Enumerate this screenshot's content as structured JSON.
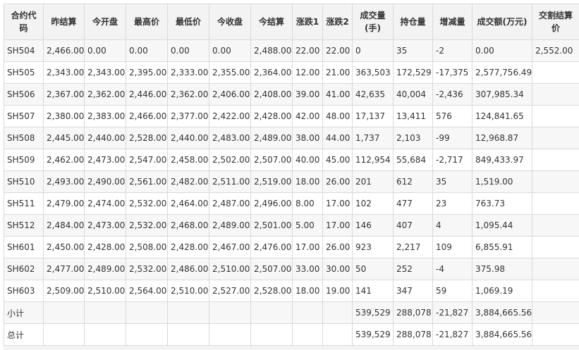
{
  "headers": [
    "合约代码",
    "昨结算",
    "今开盘",
    "最高价",
    "最低价",
    "今收盘",
    "今结算",
    "涨跌1",
    "涨跌2",
    "成交量(手)",
    "持仓量",
    "增减量",
    "成交额(万元)",
    "交割结算价"
  ],
  "rows": [
    [
      "SH504",
      "2,466.00",
      "0.00",
      "0.00",
      "0.00",
      "0.00",
      "2,488.00",
      "22.00",
      "22.00",
      "0",
      "35",
      "-2",
      "0.00",
      "2,552.00"
    ],
    [
      "SH505",
      "2,343.00",
      "2,343.00",
      "2,395.00",
      "2,333.00",
      "2,355.00",
      "2,364.00",
      "12.00",
      "21.00",
      "363,503",
      "172,529",
      "-17,375",
      "2,577,756.49",
      ""
    ],
    [
      "SH506",
      "2,367.00",
      "2,362.00",
      "2,446.00",
      "2,362.00",
      "2,406.00",
      "2,408.00",
      "39.00",
      "41.00",
      "42,635",
      "40,004",
      "-2,436",
      "307,985.34",
      ""
    ],
    [
      "SH507",
      "2,380.00",
      "2,383.00",
      "2,466.00",
      "2,377.00",
      "2,422.00",
      "2,428.00",
      "42.00",
      "48.00",
      "17,137",
      "13,411",
      "576",
      "124,841.65",
      ""
    ],
    [
      "SH508",
      "2,445.00",
      "2,440.00",
      "2,528.00",
      "2,440.00",
      "2,483.00",
      "2,489.00",
      "38.00",
      "44.00",
      "1,737",
      "2,103",
      "-99",
      "12,968.87",
      ""
    ],
    [
      "SH509",
      "2,462.00",
      "2,473.00",
      "2,547.00",
      "2,458.00",
      "2,502.00",
      "2,507.00",
      "40.00",
      "45.00",
      "112,954",
      "55,684",
      "-2,717",
      "849,433.97",
      ""
    ],
    [
      "SH510",
      "2,493.00",
      "2,490.00",
      "2,561.00",
      "2,482.00",
      "2,511.00",
      "2,519.00",
      "18.00",
      "26.00",
      "201",
      "612",
      "35",
      "1,519.00",
      ""
    ],
    [
      "SH511",
      "2,479.00",
      "2,474.00",
      "2,532.00",
      "2,464.00",
      "2,487.00",
      "2,496.00",
      "8.00",
      "17.00",
      "102",
      "477",
      "23",
      "763.73",
      ""
    ],
    [
      "SH512",
      "2,484.00",
      "2,473.00",
      "2,532.00",
      "2,468.00",
      "2,489.00",
      "2,501.00",
      "5.00",
      "17.00",
      "146",
      "407",
      "4",
      "1,095.44",
      ""
    ],
    [
      "SH601",
      "2,450.00",
      "2,428.00",
      "2,508.00",
      "2,428.00",
      "2,467.00",
      "2,476.00",
      "17.00",
      "26.00",
      "923",
      "2,217",
      "109",
      "6,855.91",
      ""
    ],
    [
      "SH602",
      "2,477.00",
      "2,489.00",
      "2,532.00",
      "2,486.00",
      "2,510.00",
      "2,507.00",
      "33.00",
      "30.00",
      "50",
      "252",
      "-4",
      "375.98",
      ""
    ],
    [
      "SH603",
      "2,509.00",
      "2,510.00",
      "2,564.00",
      "2,510.00",
      "2,527.00",
      "2,528.00",
      "18.00",
      "19.00",
      "141",
      "347",
      "59",
      "1,069.19",
      ""
    ],
    [
      "小计",
      "",
      "",
      "",
      "",
      "",
      "",
      "",
      "",
      "539,529",
      "288,078",
      "-21,827",
      "3,884,665.56",
      ""
    ],
    [
      "总计",
      "",
      "",
      "",
      "",
      "",
      "",
      "",
      "",
      "539,529",
      "288,078",
      "-21,827",
      "3,884,665.56",
      ""
    ]
  ]
}
